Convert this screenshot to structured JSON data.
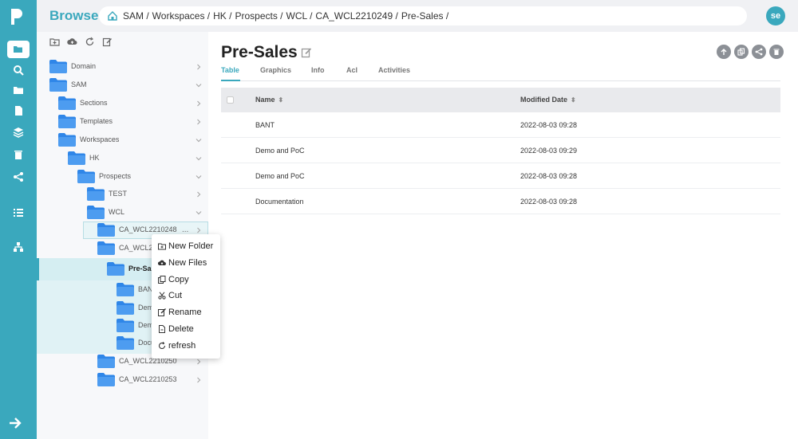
{
  "app": {
    "brand": "Browse",
    "user_initials": "se"
  },
  "colors": {
    "accent": "#3aa8bd",
    "folder": "#2f86e8"
  },
  "breadcrumb": [
    "SAM /",
    "Workspaces /",
    "HK /",
    "Prospects /",
    "WCL /",
    "CA_WCL2210249 /",
    "Pre-Sales /"
  ],
  "tree": {
    "rows": [
      {
        "label": "Domain",
        "chev": "right"
      },
      {
        "label": "SAM",
        "chev": "down"
      },
      {
        "label": "Sections",
        "chev": "right"
      },
      {
        "label": "Templates",
        "chev": "right"
      },
      {
        "label": "Workspaces",
        "chev": "down"
      },
      {
        "label": "HK",
        "chev": "down"
      },
      {
        "label": "Prospects",
        "chev": "down"
      },
      {
        "label": "TEST",
        "chev": "right"
      },
      {
        "label": "WCL",
        "chev": "down"
      },
      {
        "label": "CA_WCL2210248",
        "chev": "right"
      },
      {
        "label": "CA_WCL22",
        "chev": "none"
      },
      {
        "label": "Pre-Sal",
        "chev": "none"
      },
      {
        "label": "BAN",
        "chev": "none"
      },
      {
        "label": "Dem",
        "chev": "none"
      },
      {
        "label": "Dem",
        "chev": "none"
      },
      {
        "label": "Docu",
        "chev": "none"
      },
      {
        "label": "CA_WCL2210250",
        "chev": "right"
      },
      {
        "label": "CA_WCL2210253",
        "chev": "right"
      }
    ],
    "more_dots": "..."
  },
  "main": {
    "title": "Pre-Sales",
    "tabs": [
      "Table",
      "Graphics",
      "Info",
      "Acl",
      "Activities"
    ],
    "active_tab": "Table",
    "table": {
      "columns": [
        "Name",
        "Modified Date"
      ],
      "rows": [
        {
          "name": "BANT",
          "modified": "2022-08-03 09:28"
        },
        {
          "name": "Demo and PoC",
          "modified": "2022-08-03 09:29"
        },
        {
          "name": "Demo and PoC",
          "modified": "2022-08-03 09:28"
        },
        {
          "name": "Documentation",
          "modified": "2022-08-03 09:28"
        }
      ]
    }
  },
  "context_menu": {
    "items": [
      {
        "label": "New Folder",
        "icon": "new-folder-icon"
      },
      {
        "label": "New Files",
        "icon": "upload-cloud-icon"
      },
      {
        "label": "Copy",
        "icon": "copy-icon"
      },
      {
        "label": "Cut",
        "icon": "scissors-icon"
      },
      {
        "label": "Rename",
        "icon": "rename-icon"
      },
      {
        "label": "Delete",
        "icon": "delete-file-icon"
      },
      {
        "label": "refresh",
        "icon": "refresh-icon"
      }
    ]
  }
}
